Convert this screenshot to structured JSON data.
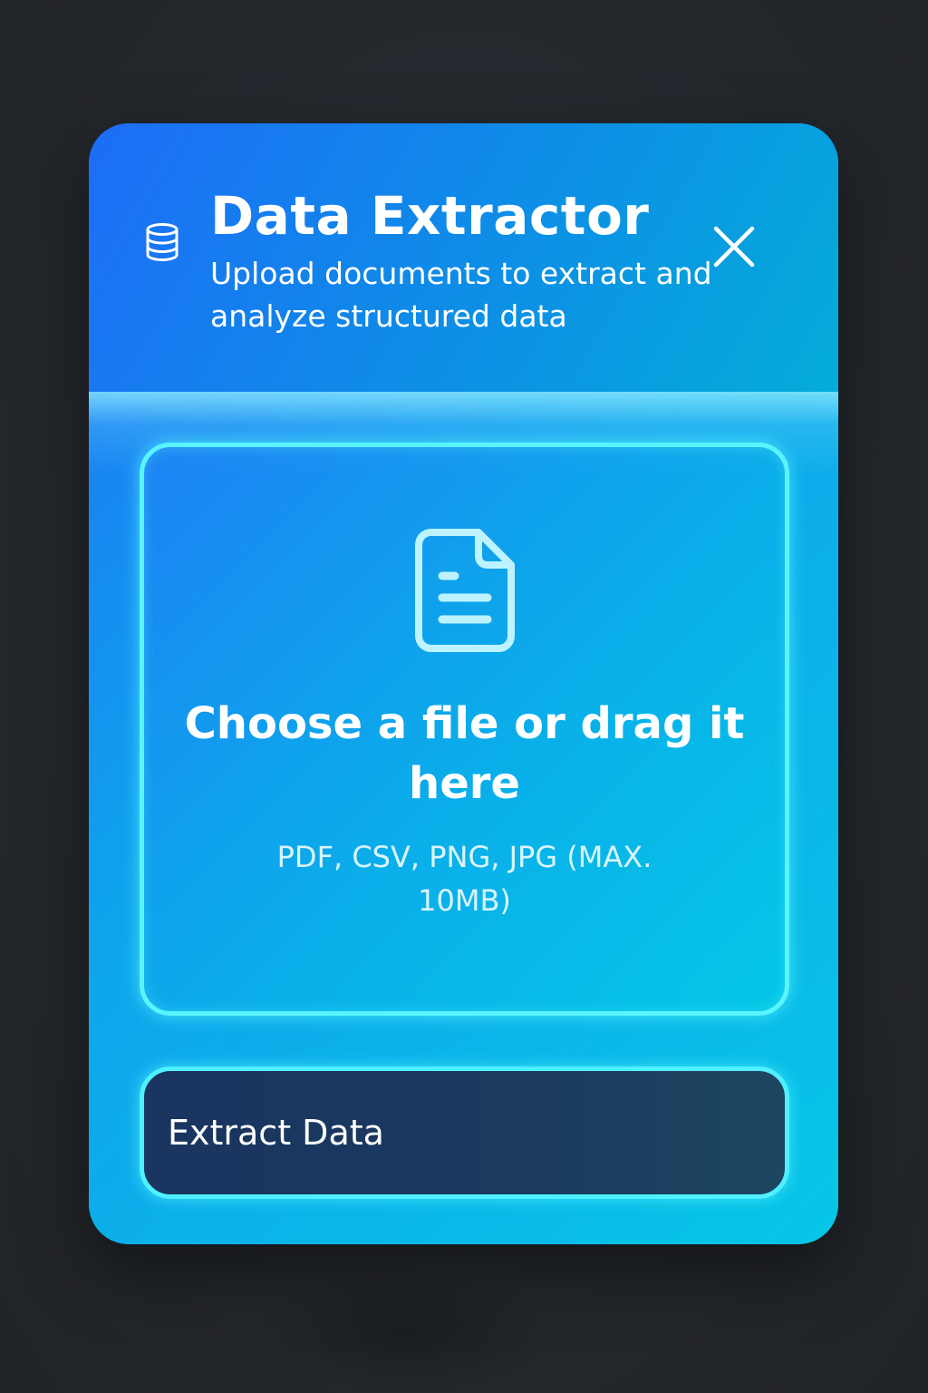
{
  "dialog": {
    "title": "Data Extractor",
    "subtitle": "Upload documents to extract and analyze structured data",
    "header_icon": "database-icon",
    "close_icon": "close-icon"
  },
  "dropzone": {
    "icon": "file-document-icon",
    "title": "Choose a file or drag it here",
    "hint": "PDF, CSV, PNG, JPG (MAX. 10MB)"
  },
  "actions": {
    "extract_label": "Extract Data"
  },
  "colors": {
    "accent_glow": "#5af4ff",
    "gradient_start": "#1f6ff7",
    "gradient_end": "#07c6e6",
    "button_bg": "#1a3560",
    "page_bg": "#25282d"
  }
}
